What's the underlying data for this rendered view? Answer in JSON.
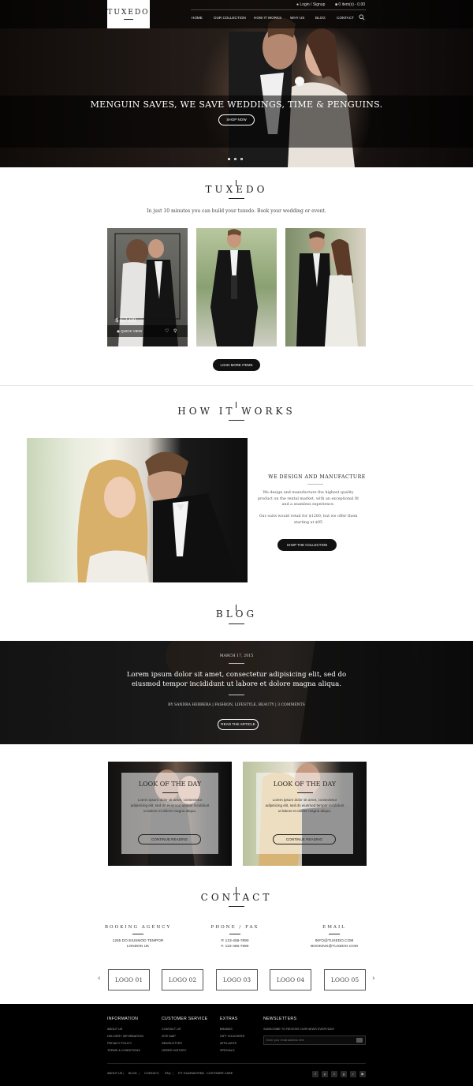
{
  "header": {
    "logo": "TUXEDO",
    "login": "Login / Signup",
    "cart": "0 item(s) - 0.00",
    "nav": [
      "HOME",
      "OUR COLLECTION",
      "HOW IT WORKS",
      "WHY US",
      "BLOG",
      "CONTACT"
    ]
  },
  "hero": {
    "title": "MENGUIN SAVES, WE SAVE WEDDINGS, TIME & PENGUINS.",
    "button": "SHOP NOW"
  },
  "tuxedo": {
    "title": "TUXEDO",
    "lead": "In just 10 minutes you can build your tuxedo. Book your wedding or event.",
    "price": "$ 67.00",
    "quick_view": "QUICK VIEW",
    "load_more": "LOAD MORE ITEMS"
  },
  "how": {
    "title": "HOW IT WORKS",
    "heading": "WE DESIGN AND MANUFACTURE",
    "p1": "We design and manufacture the highest quality product on the rental market, with an exceptional fit and a seamless experience.",
    "p2": "Our suits would retail for $1200, but we offer them starting at $95",
    "button": "SHOP THE COLLECTION"
  },
  "blog": {
    "title": "BLOG",
    "date": "MARCH 17, 2015",
    "headline": "Lorem ipsum dolor sit amet, consectetur adipisicing elit, sed do eiusmod tempor incididunt ut labore et dolore magna aliqua.",
    "meta": "BY SANDRA HERRERA | FASHION, LIFESTYLE, BEAUTY | 3 COMMENTS",
    "button": "READ THE ARTICLE"
  },
  "looks": [
    {
      "title": "LOOK OF THE DAY",
      "copy": "Lorem ipsum dolor sit amet, consectetur adipisicing elit, sed do eiusmod tempor incididunt ut labore et dolore magna aliqua.",
      "button": "CONTINUE READING"
    },
    {
      "title": "LOOK OF THE DAY",
      "copy": "Lorem ipsum dolor sit amet, consectetur adipisicing elit, sed do eiusmod tempor incididunt ut labore et dolore magna aliqua.",
      "button": "CONTINUE READING"
    }
  ],
  "contact": {
    "title": "CONTACT",
    "booking_h": "BOOKING AGENCY",
    "booking_1": "1255 DO EIUSMOD TEMPOR",
    "booking_2": "LONDON UK",
    "phone_h": "PHONE / FAX",
    "phone_1": "P. 123-456-7890",
    "phone_2": "F. 123-456-7890",
    "email_h": "EMAIL",
    "email_1": "INFO@TUXEDO.COM",
    "email_2": "BOOKING@TUXEDO.COM"
  },
  "logos": [
    "LOGO 01",
    "LOGO 02",
    "LOGO 03",
    "LOGO 04",
    "LOGO 05"
  ],
  "footer": {
    "information": {
      "title": "INFORMATION",
      "links": [
        "ABOUT US",
        "DELIVERY INFORMATION",
        "PRIVACY POLICY",
        "TERMS & CONDITIONS"
      ]
    },
    "customer": {
      "title": "CUSTOMER SERVICE",
      "links": [
        "CONTACT US",
        "SITE MAP",
        "NEWSLETTER",
        "ORDER HISTORY"
      ]
    },
    "extras": {
      "title": "EXTRAS",
      "links": [
        "BRANDS",
        "GIFT VOUCHERS",
        "AFFILIATES",
        "SPECIALS"
      ]
    },
    "newsletter": {
      "title": "NEWSLETTERS",
      "text": "SUBSCRIBE TO RECEIVE OUR NEWS EVERYDAY!",
      "placeholder": "Enter your email address here"
    },
    "bottom_links": [
      "ABOUT US",
      "BLOG",
      "CONTACT",
      "FAQ",
      "FIT GUARANTEED",
      "CUSTOMER CARE"
    ],
    "social": [
      "facebook-icon",
      "pinterest-icon",
      "twitter-icon",
      "google-plus-icon",
      "rss-icon",
      "youtube-icon"
    ]
  }
}
